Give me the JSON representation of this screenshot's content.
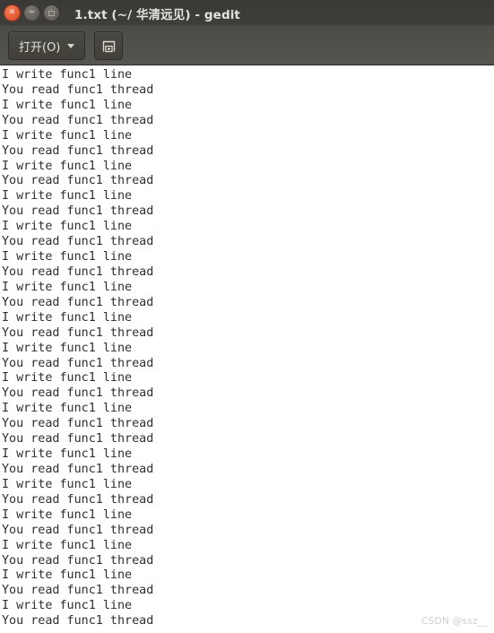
{
  "window": {
    "title": "1.txt (~/ 华清远见) - gedit",
    "controls": [
      {
        "name": "close",
        "glyph": "✕"
      },
      {
        "name": "minimize",
        "glyph": "−"
      },
      {
        "name": "maximize",
        "glyph": "□"
      }
    ],
    "colors": {
      "header_top": "#3b3a36",
      "header_bottom": "#57554f",
      "close_button": "#e8633b",
      "title_text": "#e6e3dd",
      "document_background": "#ffffff",
      "document_text": "#2b2f33",
      "watermark_text": "#cfcfcf"
    }
  },
  "toolbar": {
    "open_label": "打开(O)",
    "open_icon": "chevron-down-icon",
    "save_icon": "save-icon"
  },
  "document": {
    "filename": "1.txt",
    "lines": [
      "I write func1 line",
      "You read func1 thread",
      "I write func1 line",
      "You read func1 thread",
      "I write func1 line",
      "You read func1 thread",
      "I write func1 line",
      "You read func1 thread",
      "I write func1 line",
      "You read func1 thread",
      "I write func1 line",
      "You read func1 thread",
      "I write func1 line",
      "You read func1 thread",
      "I write func1 line",
      "You read func1 thread",
      "I write func1 line",
      "You read func1 thread",
      "I write func1 line",
      "You read func1 thread",
      "I write func1 line",
      "You read func1 thread",
      "I write func1 line",
      "You read func1 thread",
      "You read func1 thread",
      "I write func1 line",
      "You read func1 thread",
      "I write func1 line",
      "You read func1 thread",
      "I write func1 line",
      "You read func1 thread",
      "I write func1 line",
      "You read func1 thread",
      "I write func1 line",
      "You read func1 thread",
      "I write func1 line",
      "You read func1 thread"
    ]
  },
  "watermark": {
    "text": "CSDN @ssz__"
  }
}
